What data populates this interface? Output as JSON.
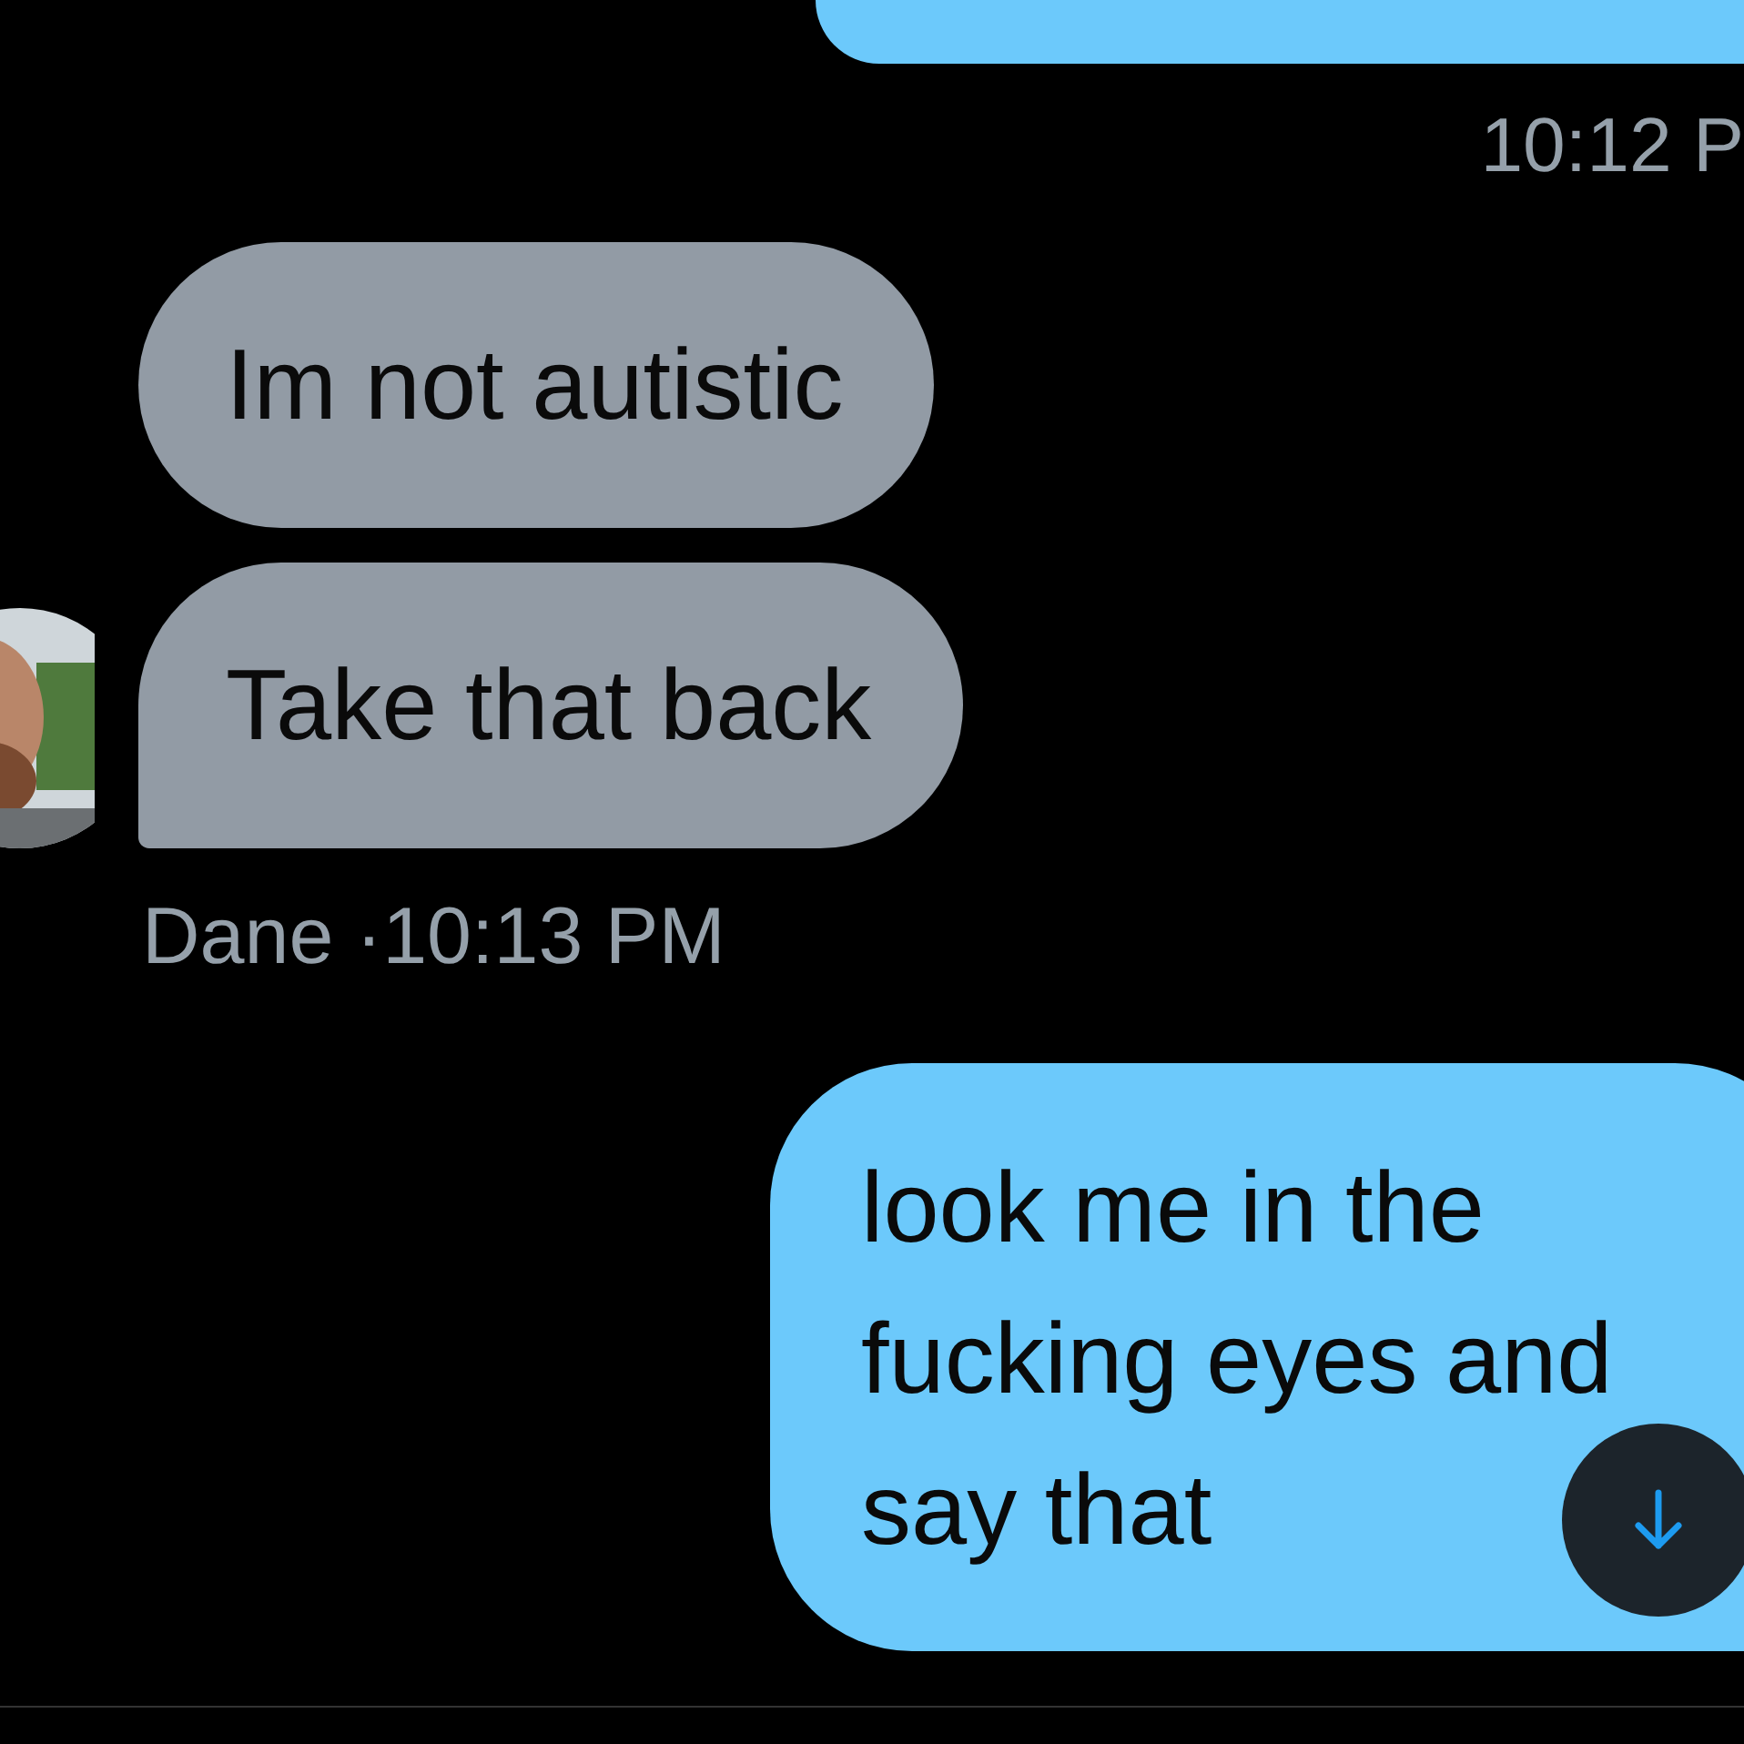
{
  "messages": [
    {
      "kind": "outgoing_cut"
    },
    {
      "kind": "timestamp",
      "text": "10:12 P"
    },
    {
      "kind": "incoming",
      "text": "Im not autistic",
      "tail": false
    },
    {
      "kind": "incoming",
      "text": "Take that back",
      "tail": true
    },
    {
      "kind": "meta",
      "sender": "Dane",
      "separator": "·",
      "time": "10:13 PM"
    },
    {
      "kind": "outgoing",
      "text": "look me in the fucking eyes and say that"
    }
  ],
  "scroll_button": {
    "kind": "scroll_down"
  }
}
